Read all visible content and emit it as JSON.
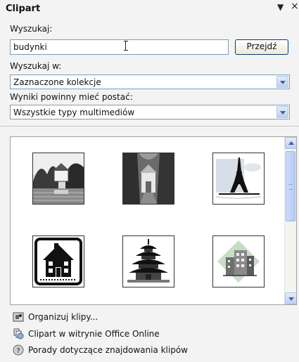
{
  "pane": {
    "title": "Clipart",
    "menu_glyph": "▼",
    "close_glyph": "×"
  },
  "search": {
    "label": "Wyszukaj:",
    "value": "budynki",
    "go_label": "Przejdź"
  },
  "search_in": {
    "label": "Wyszukaj w:",
    "selected": "Zaznaczone kolekcje"
  },
  "results_type": {
    "label": "Wyniki powinny mieć postać:",
    "selected": "Wszystkie typy multimediów"
  },
  "results": {
    "items": [
      {
        "name": "photo-house-by-lake"
      },
      {
        "name": "photo-building-in-trees"
      },
      {
        "name": "eiffel-tower-clipart"
      },
      {
        "name": "house-icon-clipart"
      },
      {
        "name": "pagoda-clipart"
      },
      {
        "name": "office-buildings-clipart"
      }
    ]
  },
  "footer": {
    "links": [
      {
        "label": "Organizuj klipy...",
        "icon": "organize-icon"
      },
      {
        "label": "Clipart w witrynie Office Online",
        "icon": "office-online-icon"
      },
      {
        "label": "Porady dotyczące znajdowania klipów",
        "icon": "help-icon"
      }
    ]
  }
}
